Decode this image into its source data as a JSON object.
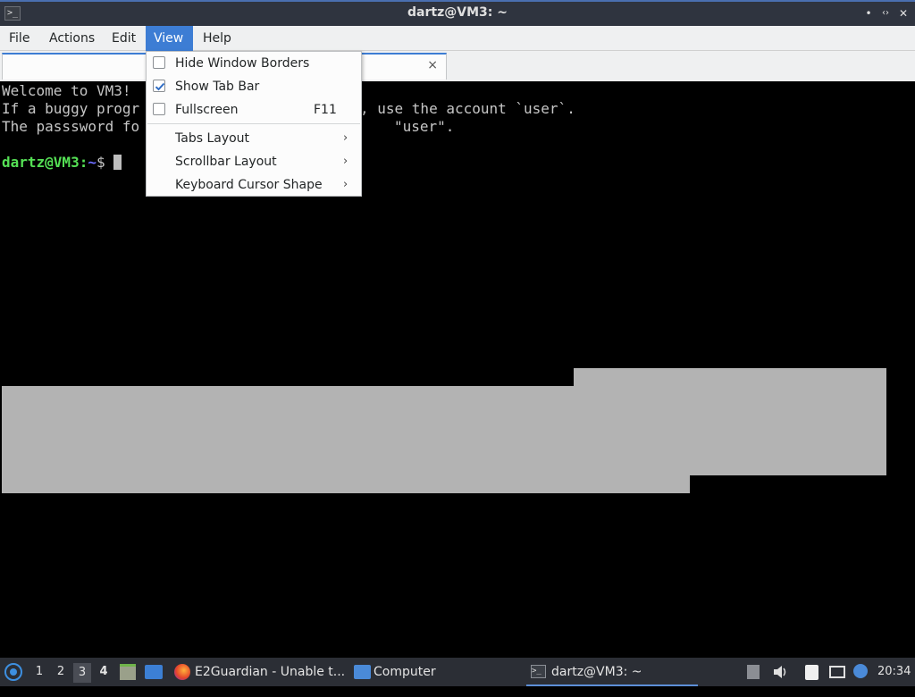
{
  "window": {
    "title": "dartz@VM3: ~",
    "icon": "terminal-icon",
    "controls": {
      "minimize": "•",
      "maximize": "‹›",
      "close": "✕"
    }
  },
  "menubar": {
    "items": [
      "File",
      "Actions",
      "Edit",
      "View",
      "Help"
    ],
    "active": "View"
  },
  "tab": {
    "close": "×"
  },
  "terminal": {
    "lines": [
      "Welcome to VM3!",
      "If a buggy progr",
      "The passsword fo"
    ],
    "line2_tail": ", use the account `user`.",
    "line3_tail": "\"user\".",
    "prompt_user": "dartz@VM3",
    "prompt_sep": ":",
    "prompt_path": "~",
    "prompt_symbol": "$"
  },
  "view_menu": {
    "items": [
      {
        "label": "Hide Window Borders",
        "checked": false
      },
      {
        "label": "Show Tab Bar",
        "checked": true
      },
      {
        "label": "Fullscreen",
        "checked": false,
        "shortcut": "F11"
      },
      {
        "label": "Tabs Layout",
        "submenu": true
      },
      {
        "label": "Scrollbar Layout",
        "submenu": true
      },
      {
        "label": "Keyboard Cursor Shape",
        "submenu": true
      }
    ],
    "submenu_arrow": "›"
  },
  "taskbar": {
    "workspaces": [
      "1",
      "2",
      "3",
      "4"
    ],
    "active_workspace": "3",
    "tasks": [
      {
        "label": "E2Guardian - Unable t...",
        "icon": "firefox-icon"
      },
      {
        "label": "Computer",
        "icon": "folder-icon"
      },
      {
        "label": "dartz@VM3: ~",
        "icon": "terminal-icon",
        "active": true
      }
    ],
    "clock": "20:34"
  },
  "colors": {
    "accent": "#3d7dd4",
    "prompt_user": "#55e055",
    "prompt_path": "#6c6cff",
    "terminal_bg": "#000000",
    "terminal_fg": "#c6c6c6"
  }
}
